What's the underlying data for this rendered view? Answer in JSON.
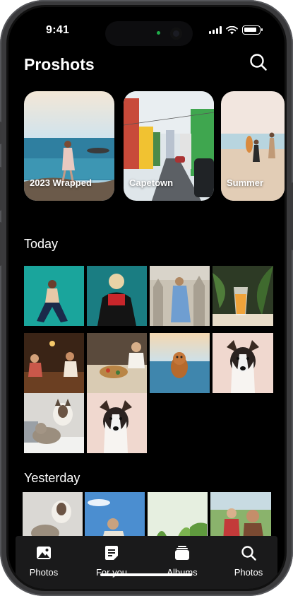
{
  "status_bar": {
    "time": "9:41"
  },
  "header": {
    "title": "Proshots",
    "search_icon": "search-icon"
  },
  "memories": [
    {
      "label": "2023 Wrapped"
    },
    {
      "label": "Capetown"
    },
    {
      "label": "Summer"
    }
  ],
  "sections": {
    "today": "Today",
    "yesterday": "Yesterday"
  },
  "tabs": [
    {
      "label": "Photos",
      "icon": "photo-icon"
    },
    {
      "label": "For you",
      "icon": "document-icon"
    },
    {
      "label": "Albums",
      "icon": "albums-icon"
    },
    {
      "label": "Photos",
      "icon": "search-icon"
    }
  ],
  "colors": {
    "background": "#000000",
    "tabbar": "#1a1a1b",
    "text": "#ffffff"
  }
}
